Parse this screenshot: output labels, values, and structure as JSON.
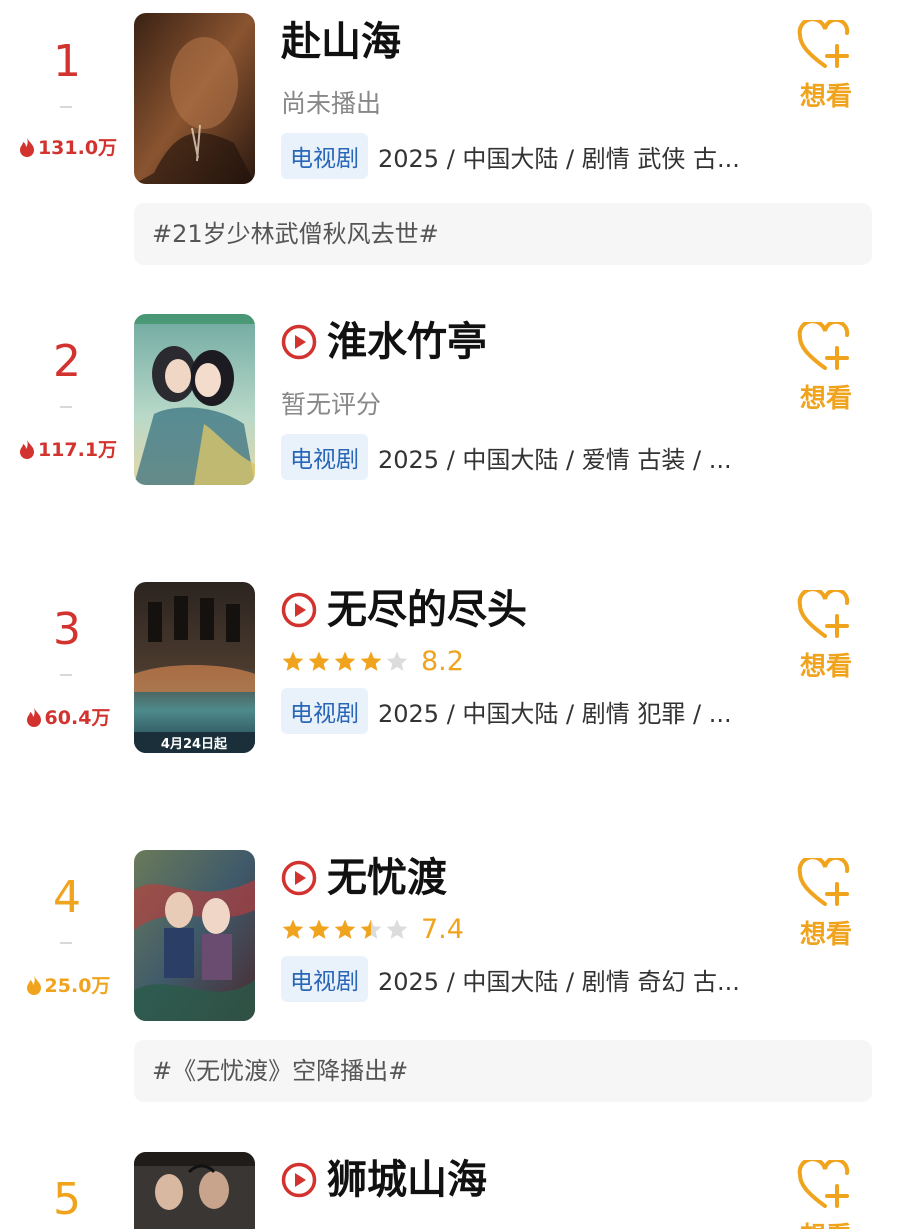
{
  "colors": {
    "rank_hot": "#d2332f",
    "rank_warm": "#f0a41e",
    "heat_hot": "#d2332f",
    "heat_warm": "#f0a41e",
    "accent": "#f0a41e",
    "tag_text": "#2a66b8",
    "tag_bg": "#e9f2fb"
  },
  "icons": {
    "flame": "flame-icon",
    "play": "play-circle-icon",
    "heart": "heart-plus-icon",
    "star": "star-icon"
  },
  "items": [
    {
      "rank": "1",
      "heat": "131.0万",
      "title": "赴山海",
      "status": "尚未播出",
      "tag": "电视剧",
      "meta": "2025 / 中国大陆 / 剧情 武侠 古...",
      "want": "想看",
      "topic": "#21岁少林武僧秋风去世#"
    },
    {
      "rank": "2",
      "heat": "117.1万",
      "title": "淮水竹亭",
      "status": "暂无评分",
      "tag": "电视剧",
      "meta": "2025 / 中国大陆 / 爱情 古装 / ...",
      "want": "想看"
    },
    {
      "rank": "3",
      "heat": "60.4万",
      "title": "无尽的尽头",
      "rating_stars": 4,
      "score": "8.2",
      "tag": "电视剧",
      "meta": "2025 / 中国大陆 / 剧情 犯罪 / ...",
      "want": "想看"
    },
    {
      "rank": "4",
      "heat": "25.0万",
      "title": "无忧渡",
      "rating_stars": 3.5,
      "score": "7.4",
      "tag": "电视剧",
      "meta": "2025 / 中国大陆 / 剧情 奇幻 古...",
      "want": "想看",
      "topic": "#《无忧渡》空降播出#"
    },
    {
      "rank": "5",
      "title": "狮城山海",
      "want": "想看"
    }
  ]
}
